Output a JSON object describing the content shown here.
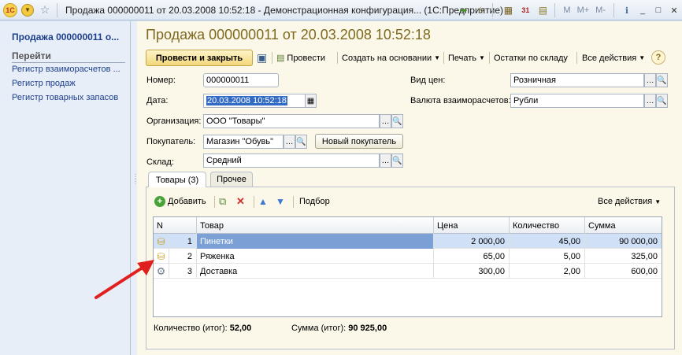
{
  "window": {
    "title": "Продажа 000000011 от 20.03.2008 10:52:18 - Демонстрационная конфигурация... (1С:Предприятие)",
    "logo": "1С",
    "small_buttons": [
      "M",
      "M+",
      "M-"
    ],
    "calendar_day": "31"
  },
  "left_panel": {
    "title": "Продажа 000000011 о...",
    "goto_label": "Перейти",
    "links": [
      "Регистр взаиморасчетов ...",
      "Регистр продаж",
      "Регистр товарных запасов"
    ]
  },
  "form": {
    "title": "Продажа 000000011 от 20.03.2008 10:52:18",
    "toolbar": {
      "post_close": "Провести и закрыть",
      "post": "Провести",
      "create_based": "Создать на основании",
      "print": "Печать",
      "stock": "Остатки по складу",
      "all_actions": "Все действия"
    },
    "fields": {
      "number_label": "Номер:",
      "number_value": "000000011",
      "date_label": "Дата:",
      "date_value": "20.03.2008 10:52:18",
      "org_label": "Организация:",
      "org_value": "ООО \"Товары\"",
      "buyer_label": "Покупатель:",
      "buyer_value": "Магазин \"Обувь\"",
      "new_buyer_button": "Новый покупатель",
      "warehouse_label": "Склад:",
      "warehouse_value": "Средний",
      "price_type_label": "Вид цен:",
      "price_type_value": "Розничная",
      "currency_label": "Валюта взаиморасчетов:",
      "currency_value": "Рубли"
    },
    "tabs": [
      {
        "label": "Товары (3)"
      },
      {
        "label": "Прочее"
      }
    ],
    "table_toolbar": {
      "add": "Добавить",
      "select": "Подбор",
      "all_actions": "Все действия"
    },
    "table": {
      "columns": [
        "N",
        "Товар",
        "Цена",
        "Количество",
        "Сумма"
      ],
      "rows": [
        {
          "n": "1",
          "item": "Пинетки",
          "price": "2 000,00",
          "qty": "45,00",
          "sum": "90 000,00",
          "icon": "coins-icon"
        },
        {
          "n": "2",
          "item": "Ряженка",
          "price": "65,00",
          "qty": "5,00",
          "sum": "325,00",
          "icon": "coins-icon"
        },
        {
          "n": "3",
          "item": "Доставка",
          "price": "300,00",
          "qty": "2,00",
          "sum": "600,00",
          "icon": "gear-icon"
        }
      ]
    },
    "totals": {
      "qty_label": "Количество (итог):",
      "qty_value": "52,00",
      "sum_label": "Сумма (итог):",
      "sum_value": "90 925,00"
    }
  },
  "colors": {
    "accent_title": "#7e6a1e",
    "link": "#1c3f8c",
    "selection": "#316ac5",
    "annotation_arrow": "#e0201e"
  }
}
